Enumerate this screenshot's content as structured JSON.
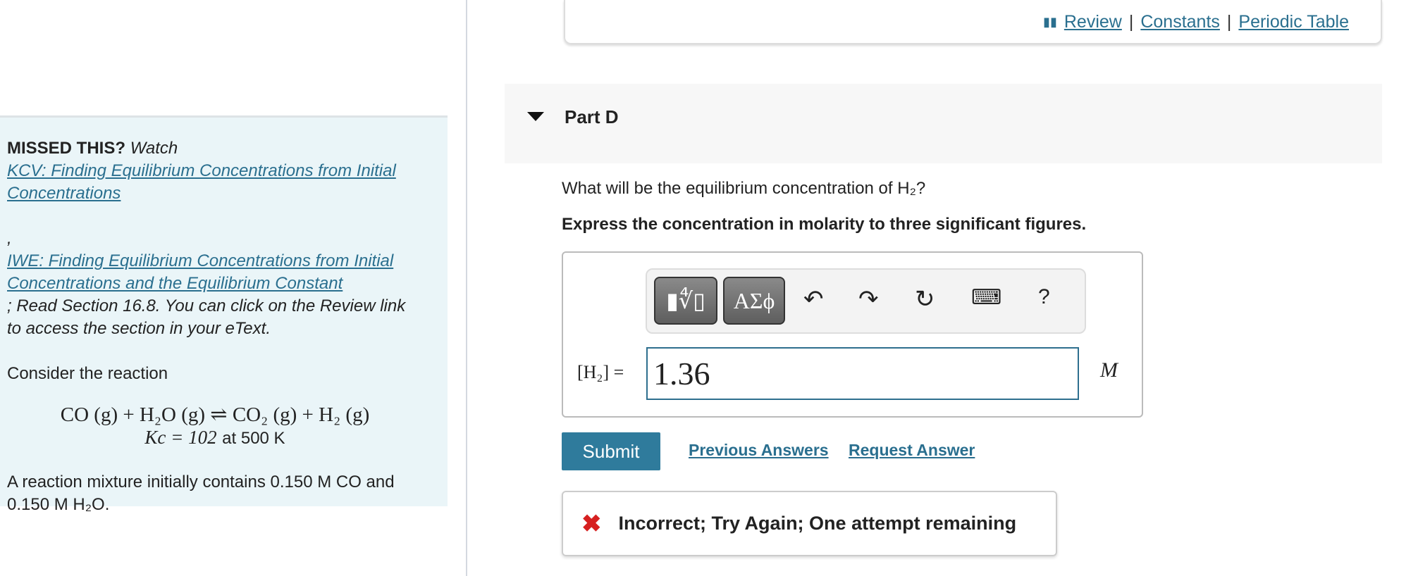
{
  "left": {
    "missed": "MISSED THIS?",
    "watch": "Watch",
    "link1": "KCV: Finding Equilibrium Concentrations from Initial Concentrations",
    "comma": ",",
    "link2": "IWE: Finding Equilibrium Concentrations from Initial Concentrations and the Equilibrium Constant",
    "read": "; Read Section 16.8. You can click on the Review link to access the section in your eText.",
    "consider": "Consider the reaction",
    "reaction": "CO (g) + H₂O (g) ⇌ CO₂ (g) + H₂ (g)",
    "kc": "Kc = 102",
    "kc_at": "at 500 K",
    "mixture": "A reaction mixture initially contains 0.150 M CO and 0.150 M H₂O."
  },
  "top_links": {
    "review": "Review",
    "constants": "Constants",
    "periodic": "Periodic Table",
    "sep": "|"
  },
  "part": {
    "title": "Part D",
    "question": "What will be the equilibrium concentration of H₂?",
    "instruction": "Express the concentration in molarity to three significant figures."
  },
  "answer": {
    "label": "[H₂] =",
    "value": "1.36",
    "unit": "M",
    "toolbar": {
      "templates": "▮∜▯",
      "symbols": "ΑΣϕ",
      "undo": "↶",
      "redo": "↷",
      "reset": "↻",
      "keyboard": "⌨",
      "help": "?"
    }
  },
  "buttons": {
    "submit": "Submit",
    "previous": "Previous Answers",
    "request": "Request Answer"
  },
  "feedback": {
    "icon": "✖",
    "text": "Incorrect; Try Again; One attempt remaining"
  }
}
